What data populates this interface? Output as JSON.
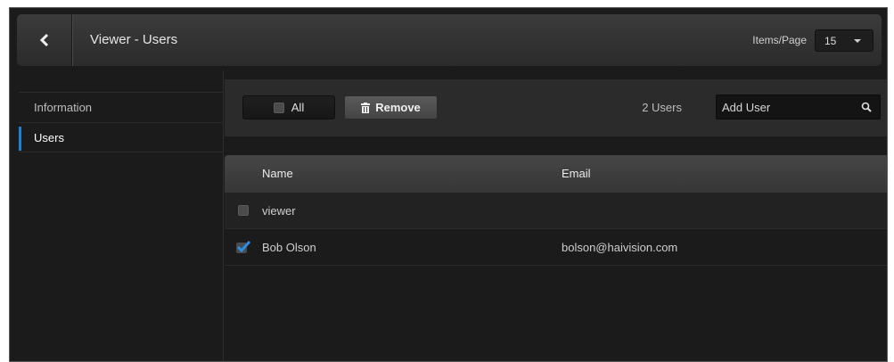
{
  "header": {
    "title": "Viewer - Users",
    "items_per_page_label": "Items/Page",
    "items_per_page_value": "15"
  },
  "sidebar": {
    "items": [
      {
        "label": "Information",
        "active": false
      },
      {
        "label": "Users",
        "active": true
      }
    ]
  },
  "toolbar": {
    "all_label": "All",
    "remove_label": "Remove",
    "users_count": "2 Users",
    "add_user_placeholder": "Add User"
  },
  "table": {
    "columns": [
      "Name",
      "Email"
    ],
    "rows": [
      {
        "name": "viewer",
        "email": "",
        "checked": false
      },
      {
        "name": "Bob Olson",
        "email": "bolson@haivision.com",
        "checked": true
      }
    ]
  },
  "colors": {
    "accent": "#1e82d4",
    "background": "#1b1b1b"
  },
  "icons": [
    "chevron-left-icon",
    "chevron-down-icon",
    "trash-icon",
    "search-icon",
    "checkmark-icon"
  ]
}
